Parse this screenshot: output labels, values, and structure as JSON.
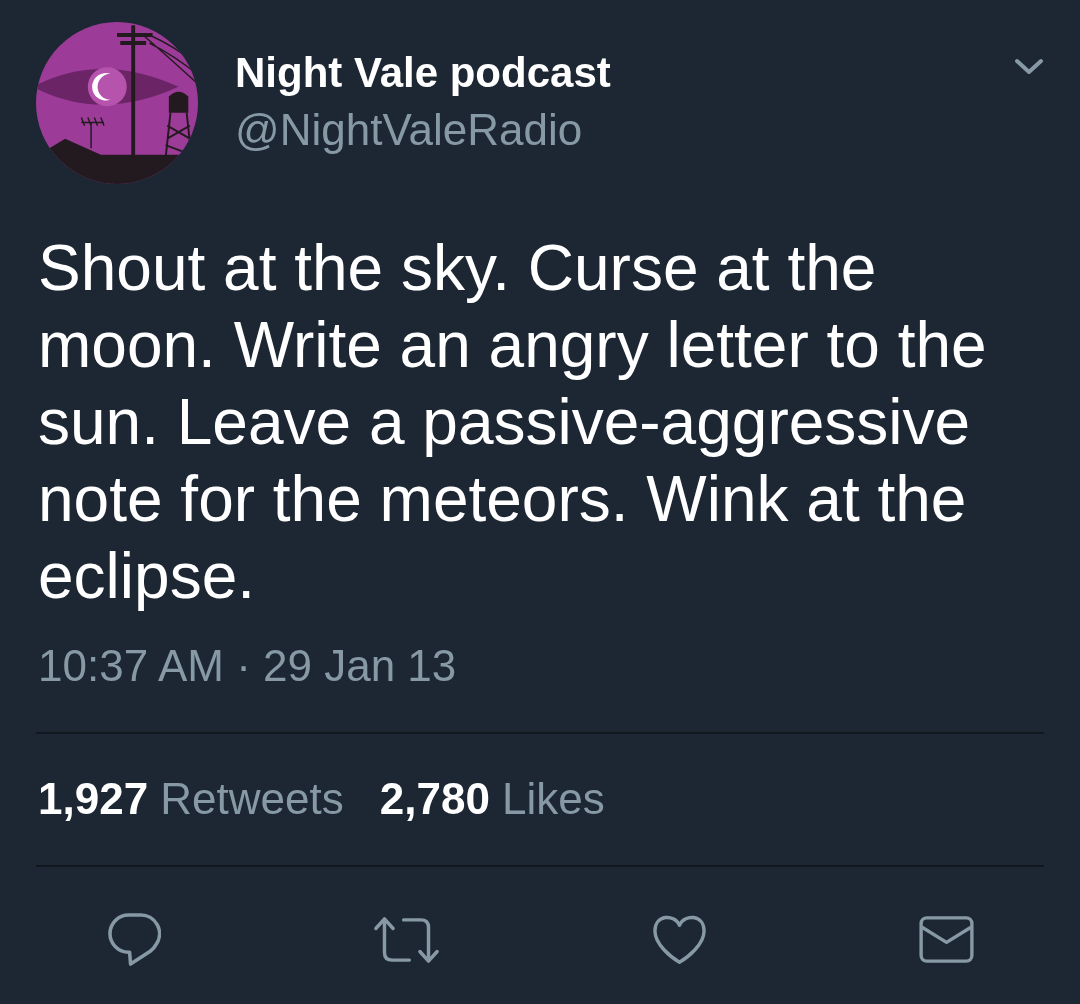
{
  "author": {
    "name": "Night Vale podcast",
    "handle": "@NightValeRadio"
  },
  "tweet": {
    "text": "Shout at the sky. Curse at the moon. Write an angry letter to the sun. Leave a passive-aggressive note for the meteors. Wink at the eclipse.",
    "time": "10:37 AM · 29 Jan 13"
  },
  "stats": [
    "**1,927** Retweets",
    "**2,780** Likes"
  ],
  "actions": [
    {
      "kind": "reply"
    },
    {
      "kind": "retweet"
    },
    {
      "kind": "like"
    },
    {
      "kind": "message"
    }
  ]
}
